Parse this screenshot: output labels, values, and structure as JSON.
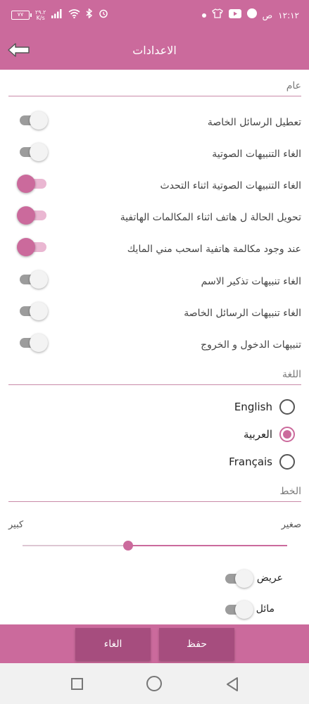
{
  "status_bar": {
    "time": "١٢:١٢",
    "am_pm": "ص",
    "battery": "٧٧",
    "net_speed_value": "٢٩.٢",
    "net_speed_unit": "K/s"
  },
  "header": {
    "title": "الاعدادات"
  },
  "general": {
    "header": "عام",
    "settings": [
      {
        "label": "تعطيل الرسائل الخاصة",
        "on": false
      },
      {
        "label": "الغاء التنبيهات الصوتية",
        "on": false
      },
      {
        "label": "الغاء التنبيهات الصوتية اثناء التحدث",
        "on": true
      },
      {
        "label": "تحويل الحالة ل هاتف اثناء المكالمات الهاتفية",
        "on": true
      },
      {
        "label": "عند وجود مكالمة هاتفية اسحب مني المايك",
        "on": true
      },
      {
        "label": "الغاء تنبيهات تذكير الاسم",
        "on": false
      },
      {
        "label": "الغاء تنبيهات الرسائل الخاصة",
        "on": false
      },
      {
        "label": "تنبيهات الدخول و الخروج",
        "on": false
      }
    ]
  },
  "language": {
    "header": "اللغة",
    "options": [
      {
        "label": "English",
        "checked": false
      },
      {
        "label": "العربية",
        "checked": true
      },
      {
        "label": "Français",
        "checked": false
      }
    ]
  },
  "font": {
    "header": "الخط",
    "size_small": "صغير",
    "size_large": "كبير",
    "size_value": 0.6,
    "bold": {
      "label": "عريض",
      "on": false
    },
    "italic": {
      "label": "مائل",
      "on": false
    }
  },
  "buttons": {
    "save": "حفظ",
    "cancel": "الغاء"
  },
  "colors": {
    "primary": "#cb6a9c",
    "button": "#a64d7e",
    "nav_bg": "#f1f1f1"
  }
}
